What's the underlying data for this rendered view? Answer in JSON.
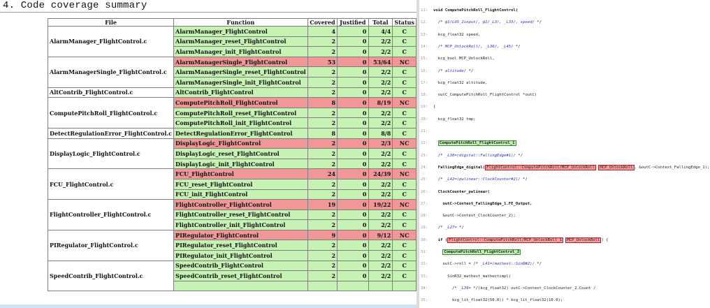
{
  "report": {
    "heading": "4. Code coverage summary",
    "columns": {
      "file": "File",
      "function": "Function",
      "covered": "Covered",
      "justified": "Justified",
      "total": "Total",
      "status": "Status"
    },
    "groups": [
      {
        "file": "AlarmManager_FlightControl.c",
        "rows": [
          {
            "function": "AlarmManager_FlightControl",
            "covered": "4",
            "justified": "0",
            "total": "4/4",
            "status": "C",
            "ok": true
          },
          {
            "function": "AlarmManager_reset_FlightControl",
            "covered": "2",
            "justified": "0",
            "total": "2/2",
            "status": "C",
            "ok": true
          },
          {
            "function": "AlarmManager_init_FlightControl",
            "covered": "2",
            "justified": "0",
            "total": "2/2",
            "status": "C",
            "ok": true
          }
        ]
      },
      {
        "file": "AlarmManagerSingle_FlightControl.c",
        "rows": [
          {
            "function": "AlarmManagerSingle_FlightControl",
            "covered": "53",
            "justified": "0",
            "total": "53/64",
            "status": "NC",
            "ok": false
          },
          {
            "function": "AlarmManagerSingle_reset_FlightControl",
            "covered": "2",
            "justified": "0",
            "total": "2/2",
            "status": "C",
            "ok": true
          },
          {
            "function": "AlarmManagerSingle_init_FlightControl",
            "covered": "2",
            "justified": "0",
            "total": "2/2",
            "status": "C",
            "ok": true
          }
        ]
      },
      {
        "file": "AltContrib_FlightControl.c",
        "rows": [
          {
            "function": "AltContrib_FlightControl",
            "covered": "2",
            "justified": "0",
            "total": "2/2",
            "status": "C",
            "ok": true
          }
        ]
      },
      {
        "file": "ComputePitchRoll_FlightControl.c",
        "rows": [
          {
            "function": "ComputePitchRoll_FlightControl",
            "covered": "8",
            "justified": "0",
            "total": "8/19",
            "status": "NC",
            "ok": false
          },
          {
            "function": "ComputePitchRoll_reset_FlightControl",
            "covered": "2",
            "justified": "0",
            "total": "2/2",
            "status": "C",
            "ok": true
          },
          {
            "function": "ComputePitchRoll_init_FlightControl",
            "covered": "2",
            "justified": "0",
            "total": "2/2",
            "status": "C",
            "ok": true
          }
        ]
      },
      {
        "file": "DetectRegulationError_FlightControl.c",
        "rows": [
          {
            "function": "DetectRegulationError_FlightControl",
            "covered": "8",
            "justified": "0",
            "total": "8/8",
            "status": "C",
            "ok": true
          }
        ]
      },
      {
        "file": "DisplayLogic_FlightControl.c",
        "rows": [
          {
            "function": "DisplayLogic_FlightControl",
            "covered": "2",
            "justified": "0",
            "total": "2/3",
            "status": "NC",
            "ok": false
          },
          {
            "function": "DisplayLogic_reset_FlightControl",
            "covered": "2",
            "justified": "0",
            "total": "2/2",
            "status": "C",
            "ok": true
          },
          {
            "function": "DisplayLogic_init_FlightControl",
            "covered": "2",
            "justified": "0",
            "total": "2/2",
            "status": "C",
            "ok": true
          }
        ]
      },
      {
        "file": "FCU_FlightControl.c",
        "rows": [
          {
            "function": "FCU_FlightControl",
            "covered": "24",
            "justified": "0",
            "total": "24/39",
            "status": "NC",
            "ok": false
          },
          {
            "function": "FCU_reset_FlightControl",
            "covered": "2",
            "justified": "0",
            "total": "2/2",
            "status": "C",
            "ok": true
          },
          {
            "function": "FCU_init_FlightControl",
            "covered": "2",
            "justified": "0",
            "total": "2/2",
            "status": "C",
            "ok": true
          }
        ]
      },
      {
        "file": "FlightController_FlightControl.c",
        "rows": [
          {
            "function": "FlightController_FlightControl",
            "covered": "19",
            "justified": "0",
            "total": "19/22",
            "status": "NC",
            "ok": false
          },
          {
            "function": "FlightController_reset_FlightControl",
            "covered": "2",
            "justified": "0",
            "total": "2/2",
            "status": "C",
            "ok": true
          },
          {
            "function": "FlightController_init_FlightControl",
            "covered": "2",
            "justified": "0",
            "total": "2/2",
            "status": "C",
            "ok": true
          }
        ]
      },
      {
        "file": "PIRegulator_FlightControl.c",
        "rows": [
          {
            "function": "PIRegulator_FlightControl",
            "covered": "9",
            "justified": "0",
            "total": "9/12",
            "status": "NC",
            "ok": false
          },
          {
            "function": "PIRegulator_reset_FlightControl",
            "covered": "2",
            "justified": "0",
            "total": "2/2",
            "status": "C",
            "ok": true
          },
          {
            "function": "PIRegulator_init_FlightControl",
            "covered": "2",
            "justified": "0",
            "total": "2/2",
            "status": "C",
            "ok": true
          }
        ]
      },
      {
        "file": "SpeedContrib_FlightControl.c",
        "rows": [
          {
            "function": "SpeedContrib_FlightControl",
            "covered": "2",
            "justified": "0",
            "total": "2/2",
            "status": "C",
            "ok": true
          },
          {
            "function": "SpeedContrib_reset_FlightControl",
            "covered": "2",
            "justified": "0",
            "total": "2/2",
            "status": "C",
            "ok": true
          },
          {
            "function": "",
            "covered": "",
            "justified": "",
            "total": "",
            "status": "",
            "ok": true
          }
        ]
      }
    ]
  },
  "code": {
    "lines": [
      {
        "no": "11:",
        "parts": [
          {
            "t": "void ComputePitchRoll_FlightControl(",
            "c": "kw"
          }
        ]
      },
      {
        "no": "12:",
        "parts": [
          {
            "t": "  /* ",
            "c": ""
          },
          {
            "t": "@1/LUS_2input/, @1/_L3/, _L33/, speed/",
            "c": "cm"
          },
          {
            "t": " */",
            "c": ""
          }
        ]
      },
      {
        "no": "13:",
        "parts": [
          {
            "t": "  kcg_float32 speed,",
            "c": ""
          }
        ]
      },
      {
        "no": "14:",
        "parts": [
          {
            "t": "  /* ",
            "c": ""
          },
          {
            "t": "MCP_UnlockRoll/, _L36/, _L45/",
            "c": "cm"
          },
          {
            "t": " */",
            "c": ""
          }
        ]
      },
      {
        "no": "15:",
        "parts": [
          {
            "t": "  kcg_bool MCP_UnlockRoll,",
            "c": ""
          }
        ]
      },
      {
        "no": "16:",
        "parts": [
          {
            "t": "  /* ",
            "c": ""
          },
          {
            "t": "altitude/",
            "c": "cm"
          },
          {
            "t": " */",
            "c": ""
          }
        ]
      },
      {
        "no": "17:",
        "parts": [
          {
            "t": "  kcg_float32 altitude,",
            "c": ""
          }
        ]
      },
      {
        "no": "18:",
        "parts": [
          {
            "t": "  outC_ComputePitchRoll_FlightControl *outC)",
            "c": ""
          }
        ]
      },
      {
        "no": "19:",
        "parts": [
          {
            "t": "{",
            "c": ""
          }
        ]
      },
      {
        "no": "20:",
        "parts": [
          {
            "t": "  kcg_float32 tmp;",
            "c": ""
          }
        ]
      },
      {
        "no": "21:",
        "parts": [
          {
            "t": "",
            "c": ""
          }
        ]
      },
      {
        "no": "22:",
        "parts": [
          {
            "t": "  ",
            "c": ""
          },
          {
            "t": "ComputePitchRoll_FlightControl_1",
            "c": "hl-green"
          }
        ]
      },
      {
        "no": "23:",
        "parts": [
          {
            "t": "  /* ",
            "c": ""
          },
          {
            "t": "_L38=(digital::FallingEdge#1)/",
            "c": "cm"
          },
          {
            "t": " */",
            "c": ""
          }
        ]
      },
      {
        "no": "24:",
        "parts": [
          {
            "t": "  FallingEdge_digital(",
            "c": "kw"
          },
          {
            "t": "FlightControl::ComputePitchRoll/MCP_UnlockRoll",
            "c": "hl-red"
          },
          {
            "t": " ",
            "c": ""
          },
          {
            "t": "MCP_UnlockRoll",
            "c": "hl-red"
          },
          {
            "t": ", &outC->Context_FallingEdge_1);",
            "c": ""
          }
        ]
      },
      {
        "no": "25:",
        "parts": [
          {
            "t": "  /* ",
            "c": ""
          },
          {
            "t": "_L42=(pwlinear::ClockCounter#2)/",
            "c": "cm"
          },
          {
            "t": " */",
            "c": ""
          }
        ]
      },
      {
        "no": "26:",
        "parts": [
          {
            "t": "  ClockCounter_pwlinear(",
            "c": "kw"
          }
        ]
      },
      {
        "no": "27:",
        "parts": [
          {
            "t": "    outC->Context_FallingEdge_1.FE_Output,",
            "c": "kw"
          }
        ]
      },
      {
        "no": "28:",
        "parts": [
          {
            "t": "    &outC->Context_ClockCounter_2);",
            "c": ""
          }
        ]
      },
      {
        "no": "29:",
        "parts": [
          {
            "t": "  /* ",
            "c": ""
          },
          {
            "t": "_L27=",
            "c": "cm"
          },
          {
            "t": " */",
            "c": ""
          }
        ]
      },
      {
        "no": "30:",
        "parts": [
          {
            "t": "  if (",
            "c": "kw"
          },
          {
            "t": "FlightControl::ComputePitchRoll/MCP_UnlockRoll_1",
            "c": "hl-red"
          },
          {
            "t": " ",
            "c": ""
          },
          {
            "t": "MCP_UnlockRoll",
            "c": "hl-red"
          },
          {
            "t": ") {",
            "c": ""
          }
        ]
      },
      {
        "no": "31:",
        "parts": [
          {
            "t": "    ",
            "c": ""
          },
          {
            "t": "ComputePitchRoll_FlightControl_2",
            "c": "hl-green"
          }
        ]
      },
      {
        "no": "32:",
        "parts": [
          {
            "t": "    outC->roll = /* ",
            "c": ""
          },
          {
            "t": "_L41=(mathext::SinR#2)/",
            "c": "cm"
          },
          {
            "t": " */",
            "c": ""
          }
        ]
      },
      {
        "no": "33:",
        "parts": [
          {
            "t": "      SinR32_mathext_mathextimpl(",
            "c": ""
          }
        ]
      },
      {
        "no": "34:",
        "parts": [
          {
            "t": "        /* ",
            "c": ""
          },
          {
            "t": "_L39=",
            "c": "cm"
          },
          {
            "t": " */(kcg_float32) outC->Context_ClockCounter_2.Count /",
            "c": ""
          }
        ]
      },
      {
        "no": "35:",
        "parts": [
          {
            "t": "        kcg_lit_float32(50.0)) * kcg_lit_float32(10.0);",
            "c": ""
          }
        ]
      }
    ]
  }
}
